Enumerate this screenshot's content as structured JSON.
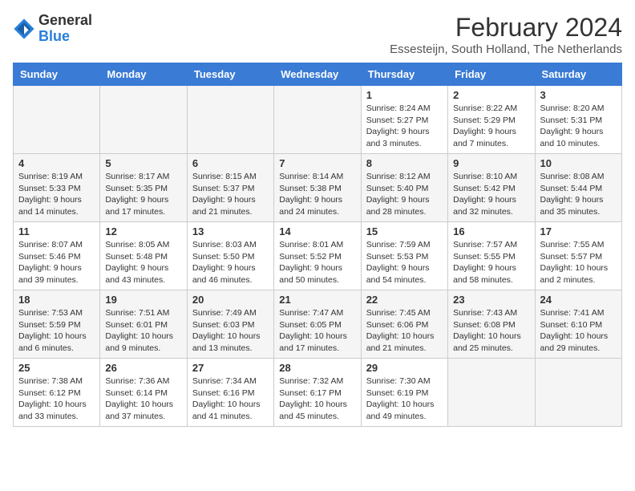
{
  "logo": {
    "general": "General",
    "blue": "Blue"
  },
  "title": "February 2024",
  "location": "Essesteijn, South Holland, The Netherlands",
  "days_of_week": [
    "Sunday",
    "Monday",
    "Tuesday",
    "Wednesday",
    "Thursday",
    "Friday",
    "Saturday"
  ],
  "weeks": [
    [
      {
        "day": "",
        "info": ""
      },
      {
        "day": "",
        "info": ""
      },
      {
        "day": "",
        "info": ""
      },
      {
        "day": "",
        "info": ""
      },
      {
        "day": "1",
        "info": "Sunrise: 8:24 AM\nSunset: 5:27 PM\nDaylight: 9 hours\nand 3 minutes."
      },
      {
        "day": "2",
        "info": "Sunrise: 8:22 AM\nSunset: 5:29 PM\nDaylight: 9 hours\nand 7 minutes."
      },
      {
        "day": "3",
        "info": "Sunrise: 8:20 AM\nSunset: 5:31 PM\nDaylight: 9 hours\nand 10 minutes."
      }
    ],
    [
      {
        "day": "4",
        "info": "Sunrise: 8:19 AM\nSunset: 5:33 PM\nDaylight: 9 hours\nand 14 minutes."
      },
      {
        "day": "5",
        "info": "Sunrise: 8:17 AM\nSunset: 5:35 PM\nDaylight: 9 hours\nand 17 minutes."
      },
      {
        "day": "6",
        "info": "Sunrise: 8:15 AM\nSunset: 5:37 PM\nDaylight: 9 hours\nand 21 minutes."
      },
      {
        "day": "7",
        "info": "Sunrise: 8:14 AM\nSunset: 5:38 PM\nDaylight: 9 hours\nand 24 minutes."
      },
      {
        "day": "8",
        "info": "Sunrise: 8:12 AM\nSunset: 5:40 PM\nDaylight: 9 hours\nand 28 minutes."
      },
      {
        "day": "9",
        "info": "Sunrise: 8:10 AM\nSunset: 5:42 PM\nDaylight: 9 hours\nand 32 minutes."
      },
      {
        "day": "10",
        "info": "Sunrise: 8:08 AM\nSunset: 5:44 PM\nDaylight: 9 hours\nand 35 minutes."
      }
    ],
    [
      {
        "day": "11",
        "info": "Sunrise: 8:07 AM\nSunset: 5:46 PM\nDaylight: 9 hours\nand 39 minutes."
      },
      {
        "day": "12",
        "info": "Sunrise: 8:05 AM\nSunset: 5:48 PM\nDaylight: 9 hours\nand 43 minutes."
      },
      {
        "day": "13",
        "info": "Sunrise: 8:03 AM\nSunset: 5:50 PM\nDaylight: 9 hours\nand 46 minutes."
      },
      {
        "day": "14",
        "info": "Sunrise: 8:01 AM\nSunset: 5:52 PM\nDaylight: 9 hours\nand 50 minutes."
      },
      {
        "day": "15",
        "info": "Sunrise: 7:59 AM\nSunset: 5:53 PM\nDaylight: 9 hours\nand 54 minutes."
      },
      {
        "day": "16",
        "info": "Sunrise: 7:57 AM\nSunset: 5:55 PM\nDaylight: 9 hours\nand 58 minutes."
      },
      {
        "day": "17",
        "info": "Sunrise: 7:55 AM\nSunset: 5:57 PM\nDaylight: 10 hours\nand 2 minutes."
      }
    ],
    [
      {
        "day": "18",
        "info": "Sunrise: 7:53 AM\nSunset: 5:59 PM\nDaylight: 10 hours\nand 6 minutes."
      },
      {
        "day": "19",
        "info": "Sunrise: 7:51 AM\nSunset: 6:01 PM\nDaylight: 10 hours\nand 9 minutes."
      },
      {
        "day": "20",
        "info": "Sunrise: 7:49 AM\nSunset: 6:03 PM\nDaylight: 10 hours\nand 13 minutes."
      },
      {
        "day": "21",
        "info": "Sunrise: 7:47 AM\nSunset: 6:05 PM\nDaylight: 10 hours\nand 17 minutes."
      },
      {
        "day": "22",
        "info": "Sunrise: 7:45 AM\nSunset: 6:06 PM\nDaylight: 10 hours\nand 21 minutes."
      },
      {
        "day": "23",
        "info": "Sunrise: 7:43 AM\nSunset: 6:08 PM\nDaylight: 10 hours\nand 25 minutes."
      },
      {
        "day": "24",
        "info": "Sunrise: 7:41 AM\nSunset: 6:10 PM\nDaylight: 10 hours\nand 29 minutes."
      }
    ],
    [
      {
        "day": "25",
        "info": "Sunrise: 7:38 AM\nSunset: 6:12 PM\nDaylight: 10 hours\nand 33 minutes."
      },
      {
        "day": "26",
        "info": "Sunrise: 7:36 AM\nSunset: 6:14 PM\nDaylight: 10 hours\nand 37 minutes."
      },
      {
        "day": "27",
        "info": "Sunrise: 7:34 AM\nSunset: 6:16 PM\nDaylight: 10 hours\nand 41 minutes."
      },
      {
        "day": "28",
        "info": "Sunrise: 7:32 AM\nSunset: 6:17 PM\nDaylight: 10 hours\nand 45 minutes."
      },
      {
        "day": "29",
        "info": "Sunrise: 7:30 AM\nSunset: 6:19 PM\nDaylight: 10 hours\nand 49 minutes."
      },
      {
        "day": "",
        "info": ""
      },
      {
        "day": "",
        "info": ""
      }
    ]
  ]
}
